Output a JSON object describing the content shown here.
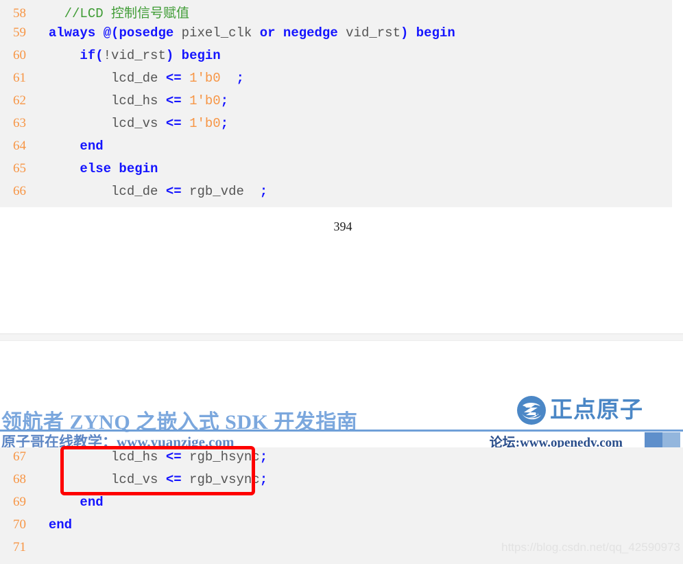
{
  "document": {
    "page_number": "394",
    "header": {
      "title": "领航者 ZYNQ 之嵌入式 SDK 开发指南",
      "subtitle": "原子哥在线教学：www.yuanzige.com",
      "forum": "论坛:www.openedv.com",
      "brand_text": "正点原子",
      "brand_color": "#4b87c6",
      "rule_color": "#6f9fd8",
      "title_color": "#7ba7dd"
    },
    "watermark": "https://blog.csdn.net/qq_42590973"
  },
  "code_top": {
    "background": "#f2f2f2",
    "lines": [
      {
        "number": "58",
        "tokens": [
          {
            "t": "    ",
            "c": "id"
          },
          {
            "t": "//LCD 控制信号赋值",
            "c": "cmt"
          }
        ]
      },
      {
        "number": "59",
        "tokens": [
          {
            "t": "  ",
            "c": "id"
          },
          {
            "t": "always",
            "c": "kw"
          },
          {
            "t": " ",
            "c": "id"
          },
          {
            "t": "@(",
            "c": "kw"
          },
          {
            "t": "posedge",
            "c": "kw"
          },
          {
            "t": " pixel_clk ",
            "c": "id"
          },
          {
            "t": "or",
            "c": "kw"
          },
          {
            "t": " ",
            "c": "id"
          },
          {
            "t": "negedge",
            "c": "kw"
          },
          {
            "t": " vid_rst",
            "c": "id"
          },
          {
            "t": ")",
            "c": "kw"
          },
          {
            "t": " ",
            "c": "id"
          },
          {
            "t": "begin",
            "c": "kw"
          }
        ]
      },
      {
        "number": "60",
        "tokens": [
          {
            "t": "      ",
            "c": "id"
          },
          {
            "t": "if",
            "c": "kw"
          },
          {
            "t": "(",
            "c": "kw"
          },
          {
            "t": "!vid_rst",
            "c": "id"
          },
          {
            "t": ")",
            "c": "kw"
          },
          {
            "t": " ",
            "c": "id"
          },
          {
            "t": "begin",
            "c": "kw"
          }
        ]
      },
      {
        "number": "61",
        "tokens": [
          {
            "t": "          lcd_de ",
            "c": "id"
          },
          {
            "t": "<=",
            "c": "op"
          },
          {
            "t": " ",
            "c": "id"
          },
          {
            "t": "1'b0",
            "c": "num"
          },
          {
            "t": "  ",
            "c": "id"
          },
          {
            "t": ";",
            "c": "op"
          }
        ]
      },
      {
        "number": "62",
        "tokens": [
          {
            "t": "          lcd_hs ",
            "c": "id"
          },
          {
            "t": "<=",
            "c": "op"
          },
          {
            "t": " ",
            "c": "id"
          },
          {
            "t": "1'b0",
            "c": "num"
          },
          {
            "t": ";",
            "c": "op"
          }
        ]
      },
      {
        "number": "63",
        "tokens": [
          {
            "t": "          lcd_vs ",
            "c": "id"
          },
          {
            "t": "<=",
            "c": "op"
          },
          {
            "t": " ",
            "c": "id"
          },
          {
            "t": "1'b0",
            "c": "num"
          },
          {
            "t": ";",
            "c": "op"
          }
        ]
      },
      {
        "number": "64",
        "tokens": [
          {
            "t": "      ",
            "c": "id"
          },
          {
            "t": "end",
            "c": "kw"
          }
        ]
      },
      {
        "number": "65",
        "tokens": [
          {
            "t": "      ",
            "c": "id"
          },
          {
            "t": "else begin",
            "c": "kw"
          }
        ]
      },
      {
        "number": "66",
        "tokens": [
          {
            "t": "          lcd_de ",
            "c": "id"
          },
          {
            "t": "<=",
            "c": "op"
          },
          {
            "t": " rgb_vde",
            "c": "id"
          },
          {
            "t": "  ",
            "c": "id"
          },
          {
            "t": ";",
            "c": "op"
          }
        ]
      }
    ]
  },
  "code_bottom": {
    "background": "#f2f2f2",
    "lines": [
      {
        "number": "67",
        "tokens": [
          {
            "t": "          lcd_hs ",
            "c": "id"
          },
          {
            "t": "<=",
            "c": "op"
          },
          {
            "t": " rgb_hsync",
            "c": "id"
          },
          {
            "t": ";",
            "c": "op"
          }
        ]
      },
      {
        "number": "68",
        "tokens": [
          {
            "t": "          lcd_vs ",
            "c": "id"
          },
          {
            "t": "<=",
            "c": "op"
          },
          {
            "t": " rgb_vsync",
            "c": "id"
          },
          {
            "t": ";",
            "c": "op"
          }
        ]
      },
      {
        "number": "69",
        "tokens": [
          {
            "t": "      ",
            "c": "id"
          },
          {
            "t": "end",
            "c": "kw"
          }
        ]
      },
      {
        "number": "70",
        "tokens": [
          {
            "t": "  ",
            "c": "id"
          },
          {
            "t": "end",
            "c": "kw"
          }
        ]
      },
      {
        "number": "71",
        "tokens": [
          {
            "t": "",
            "c": "id"
          }
        ]
      }
    ]
  },
  "annotation": {
    "highlight_box_color": "#fe0000"
  }
}
